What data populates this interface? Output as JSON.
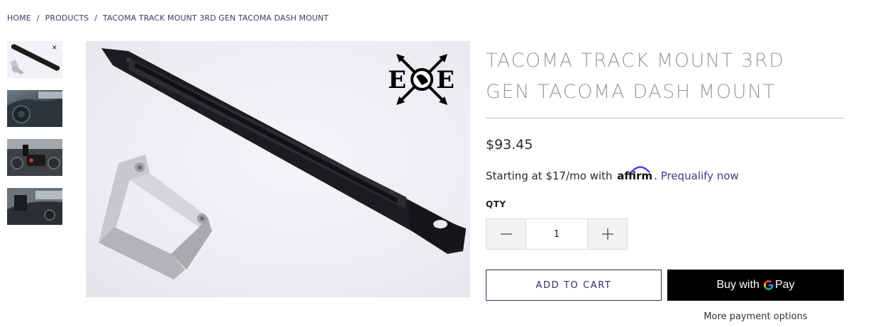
{
  "breadcrumb": {
    "home": "HOME",
    "products": "PRODUCTS",
    "current": "TACOMA TRACK MOUNT 3RD GEN TACOMA DASH MOUNT",
    "separator": "/"
  },
  "gallery": {
    "thumbnails": [
      {
        "icon": "product-thumbnail"
      },
      {
        "icon": "dash-thumbnail"
      },
      {
        "icon": "dash-mount-thumbnail"
      },
      {
        "icon": "dash-interior-thumbnail"
      }
    ],
    "brand_logo_icon": "eoe-compass-logo"
  },
  "product": {
    "title": "TACOMA TRACK MOUNT 3RD GEN TACOMA DASH MOUNT",
    "price": "$93.45",
    "affirm": {
      "prefix": "Starting at $17/mo with",
      "logo_text": "affirm",
      "suffix": ".",
      "link": "Prequalify now"
    },
    "qty_label": "QTY",
    "qty_value": "1",
    "add_to_cart": "ADD TO CART",
    "gpay": {
      "prefix": "Buy with",
      "g": "G",
      "pay": "Pay"
    },
    "more_payment": "More payment options"
  },
  "colors": {
    "accent": "#2f2f66",
    "title": "#9a9a9a",
    "affirm_arc": "#4a4af4"
  }
}
